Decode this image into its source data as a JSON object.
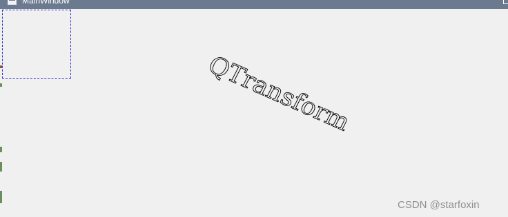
{
  "window": {
    "title": "MainWindow"
  },
  "canvas": {
    "transformed_text": "QTransform"
  },
  "watermark": {
    "text": "CSDN @starfoxin"
  },
  "colors": {
    "titlebar": "#6b7a8f",
    "client_background": "#f0f0f0",
    "dashed_rect": "#2a2ac8",
    "text": "#000000",
    "watermark": "#8f8f8f"
  }
}
